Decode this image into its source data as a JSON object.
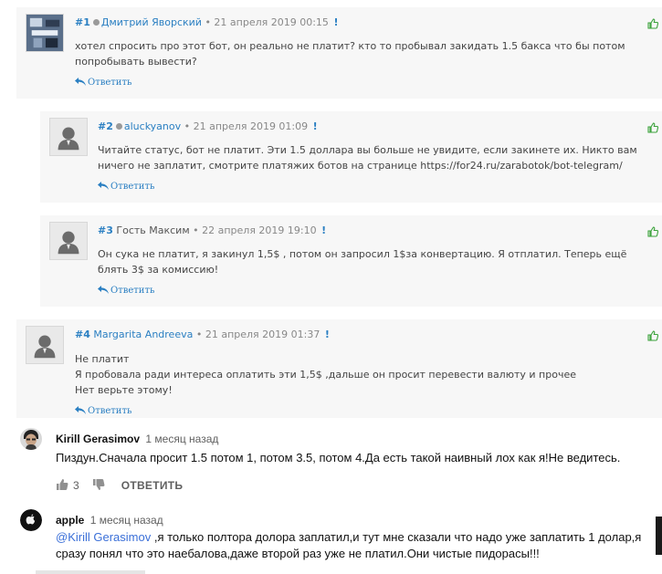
{
  "comments": [
    {
      "number": "#1",
      "author": "Дмитрий Яворский",
      "date": "• 21 апреля 2019 00:15",
      "flag": "!",
      "lines": [
        "хотел спросить про этот бот, он реально не платит? кто то пробывал закидать 1.5 бакса что бы потом попробывать вывести?"
      ],
      "reply": "Ответить"
    },
    {
      "number": "#2",
      "author": "aluckyanov",
      "date": "• 21 апреля 2019 01:09",
      "flag": "!",
      "lines": [
        "Читайте статус, бот не платит. Эти 1.5 доллара вы больше не увидите, если закинете их. Никто вам ничего не заплатит, смотрите платяжих ботов на странице https://for24.ru/zarabotok/bot-telegram/"
      ],
      "reply": "Ответить"
    },
    {
      "number": "#3",
      "author": "Гость Максим",
      "date": "• 22 апреля 2019 19:10",
      "flag": "!",
      "lines": [
        "Он сука не платит, я закинул 1,5$ , потом он запросил 1$за конвертацию. Я отплатил. Теперь ещё блять 3$ за комиссию!"
      ],
      "reply": "Ответить"
    },
    {
      "number": "#4",
      "author": "Margarita Andreeva",
      "date": "• 21 апреля 2019 01:37",
      "flag": "!",
      "lines": [
        "Не платит",
        "Я пробовала ради интереса оплатить эти 1,5$ ,дальше он просит перевести валюту и прочее",
        "Нет верьте этому!"
      ],
      "reply": "Ответить"
    }
  ],
  "yt_comments": [
    {
      "author": "Kirill Gerasimov",
      "time": "1 месяц назад",
      "text": "Пиздун.Сначала просит 1.5 потом 1, потом 3.5, потом 4.Да есть такой наивный лох как я!Не ведитесь.",
      "likes": "3",
      "reply": "ОТВЕТИТЬ"
    },
    {
      "author": "apple",
      "time": "1 месяц назад",
      "mention": "@Kirill Gerasimov",
      "text": " ,я только полтора долора заплатил,и тут мне сказали что надо уже заплатить 1 долар,я сразу понял что это наебалова,даже второй раз уже не платил.Они чистые пидорасы!!!"
    }
  ],
  "colors": {
    "link": "#2a7fc2",
    "like_green": "#3aa23a",
    "panel_bg": "#f7f7f7"
  },
  "icons": {
    "reply": "reply-arrow-icon",
    "like": "thumbs-up-icon",
    "dislike": "thumbs-down-icon"
  }
}
